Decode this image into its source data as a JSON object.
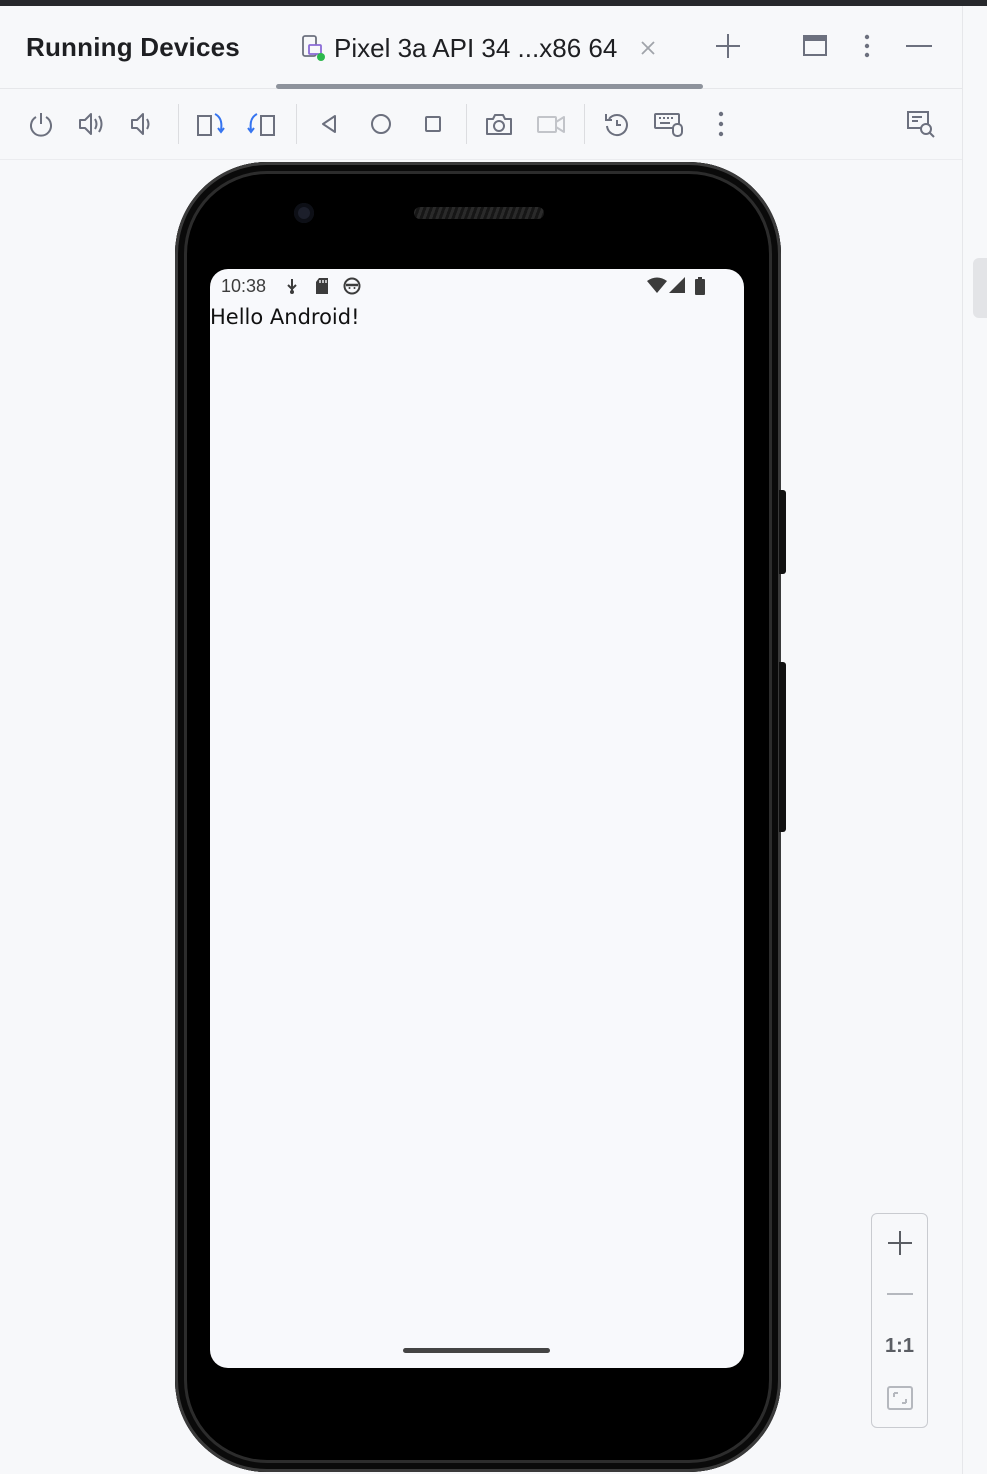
{
  "panel": {
    "title": "Running Devices"
  },
  "tab": {
    "label": "Pixel 3a API 34 ...x86 64",
    "icon": "device-icon"
  },
  "header_actions": [
    "add-icon",
    "window-icon",
    "more-vertical-icon",
    "minimize-icon"
  ],
  "toolbar": {
    "buttons": [
      "power-icon",
      "volume-up-icon",
      "volume-down-icon",
      "rotate-left-icon",
      "rotate-right-icon",
      "back-icon",
      "home-icon",
      "overview-icon",
      "screenshot-icon",
      "screen-record-icon",
      "reset-icon",
      "keyboard-mouse-icon",
      "more-vertical-icon",
      "device-mirroring-icon"
    ]
  },
  "device": {
    "status_bar": {
      "time": "10:38"
    },
    "content": {
      "text": "Hello Android!"
    }
  },
  "zoom": {
    "actual_size_label": "1:1"
  },
  "colors": {
    "accent": "#3574f0",
    "status_green": "#2db84d",
    "device_purple": "#8a6bd6"
  }
}
